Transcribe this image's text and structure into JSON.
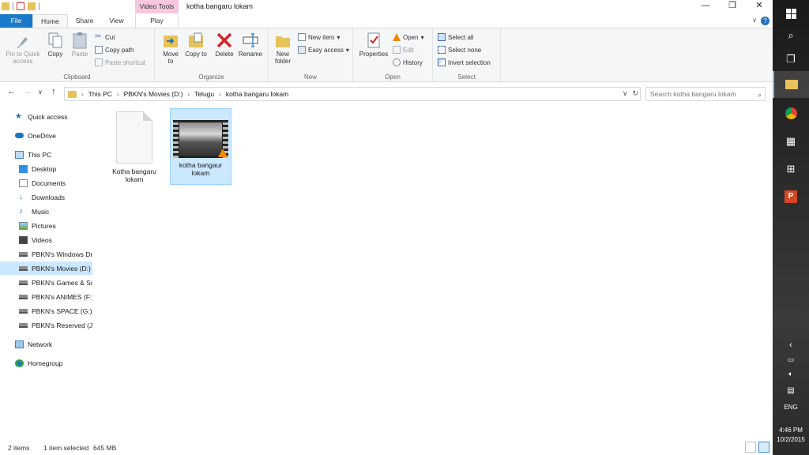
{
  "window": {
    "title": "kotha bangaru lokam",
    "context_tab_group": "Video Tools",
    "buttons": {
      "minimize": "—",
      "maximize": "❐",
      "close": "✕"
    }
  },
  "tabs": {
    "file": "File",
    "home": "Home",
    "share": "Share",
    "view": "View",
    "play": "Play"
  },
  "ribbon": {
    "clipboard": {
      "label": "Clipboard",
      "pin": "Pin to Quick access",
      "copy": "Copy",
      "paste": "Paste",
      "cut": "Cut",
      "copy_path": "Copy path",
      "paste_shortcut": "Paste shortcut"
    },
    "organize": {
      "label": "Organize",
      "move_to": "Move to",
      "copy_to": "Copy to",
      "delete": "Delete",
      "rename": "Rename"
    },
    "new": {
      "label": "New",
      "new_folder": "New folder",
      "new_item": "New item",
      "easy_access": "Easy access"
    },
    "open": {
      "label": "Open",
      "properties": "Properties",
      "open": "Open",
      "edit": "Edit",
      "history": "History"
    },
    "select": {
      "label": "Select",
      "select_all": "Select all",
      "select_none": "Select none",
      "invert_selection": "Invert selection"
    }
  },
  "address": {
    "crumbs": [
      "This PC",
      "PBKN's Movies (D:)",
      "Telugu",
      "kotha bangaru lokam"
    ],
    "search_placeholder": "Search kotha bangaru lokam"
  },
  "nav": {
    "quick_access": "Quick access",
    "onedrive": "OneDrive",
    "this_pc": "This PC",
    "desktop": "Desktop",
    "documents": "Documents",
    "downloads": "Downloads",
    "music": "Music",
    "pictures": "Pictures",
    "videos": "Videos",
    "drive_c": "PBKN's Windows Dr",
    "drive_d": "PBKN's Movies (D:)",
    "drive_e": "PBKN's Games & Sc",
    "drive_f": "PBKN's ANIMES (F:)",
    "drive_g": "PBKN's SPACE (G:)",
    "drive_j": "PBKN's Reserved (J:",
    "network": "Network",
    "homegroup": "Homegroup"
  },
  "files": [
    {
      "name": "Kotha bangaru lokam",
      "type": "document"
    },
    {
      "name": "kotha bangaur lokam",
      "type": "video"
    }
  ],
  "status": {
    "items": "2 items",
    "selected": "1 item selected",
    "size": "645 MB"
  },
  "taskbar": {
    "language": "ENG",
    "time": "4:46 PM",
    "date": "10/2/2015"
  },
  "colors": {
    "file_tab": "#1979ca",
    "selection": "#cce8ff",
    "context_tab": "#f7c6df"
  }
}
